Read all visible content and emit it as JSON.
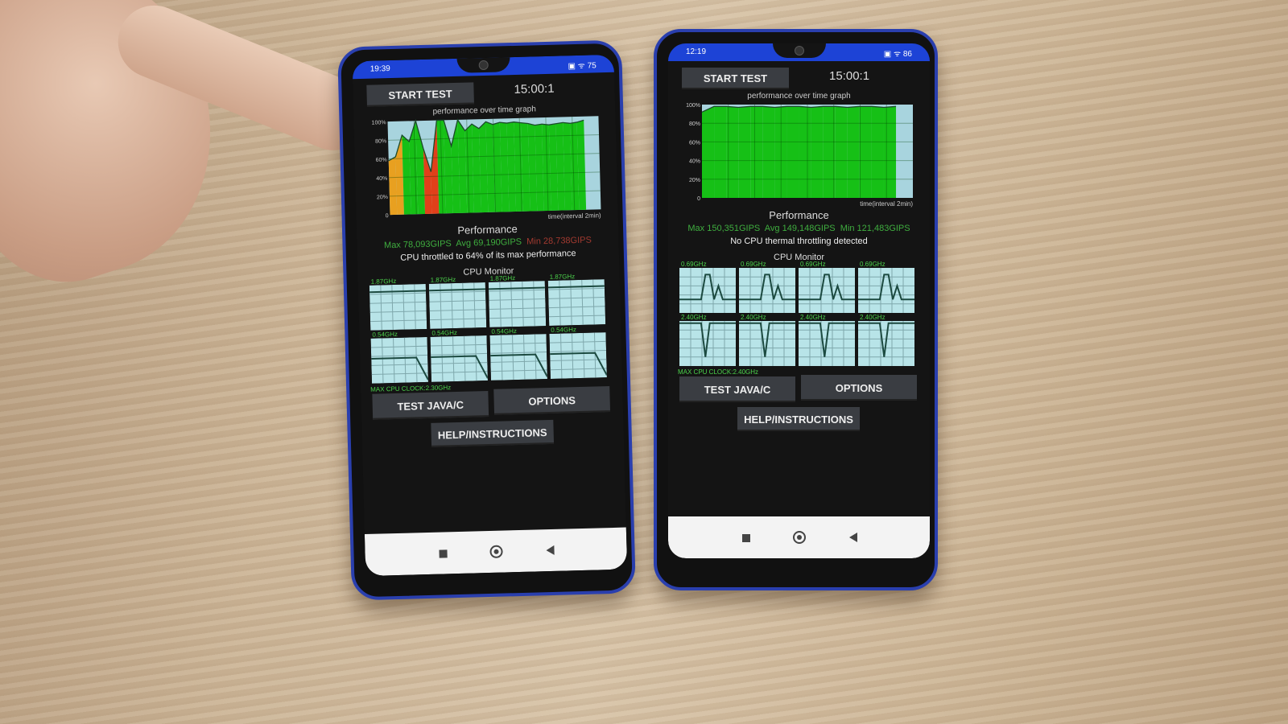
{
  "phones": [
    {
      "status_time": "19:39",
      "status_icons": "▣ ᯤ 75",
      "battery": "75",
      "start_test": "START TEST",
      "timer": "15:00:1",
      "graph_title": "performance over time graph",
      "y_ticks": [
        "100%",
        "80%",
        "60%",
        "40%",
        "20%",
        "0"
      ],
      "x_label": "time(interval 2min)",
      "perf_title": "Performance",
      "max": "Max 78,093GIPS",
      "avg": "Avg 69,190GIPS",
      "min": "Min 28,738GIPS",
      "message": "CPU throttled to 64% of its max performance",
      "cpu_monitor": "CPU Monitor",
      "core_freqs": [
        "1.87GHz",
        "1.87GHz",
        "1.87GHz",
        "1.87GHz",
        "0.54GHz",
        "0.54GHz",
        "0.54GHz",
        "0.54GHz"
      ],
      "max_cpu_clock": "MAX CPU CLOCK:2.30GHz",
      "test_java": "TEST JAVA/C",
      "options": "OPTIONS",
      "help": "HELP/INSTRUCTIONS",
      "chart_data": {
        "type": "area",
        "ylabel": "",
        "xlabel": "time(interval 2min)",
        "ylim": [
          0,
          100
        ],
        "values": [
          58,
          62,
          85,
          78,
          100,
          70,
          45,
          100,
          100,
          72,
          100,
          88,
          95,
          90,
          97,
          94,
          96,
          95,
          96,
          95,
          94,
          92,
          93,
          92,
          93,
          94,
          93,
          94,
          96
        ],
        "fill_end": 0.93
      },
      "core_graphs": {
        "top": [
          0.85,
          0.85,
          0.85,
          0.85,
          0.85,
          0.85
        ],
        "bottom": [
          0.55,
          0.55,
          0.55,
          0.55,
          0.55,
          0.05
        ]
      }
    },
    {
      "status_time": "12:19",
      "status_icons": "▣ ᯤ 86",
      "battery": "86",
      "start_test": "START TEST",
      "timer": "15:00:1",
      "graph_title": "performance over time graph",
      "y_ticks": [
        "100%",
        "80%",
        "60%",
        "40%",
        "20%",
        "0"
      ],
      "x_label": "time(interval 2min)",
      "perf_title": "Performance",
      "max": "Max 150,351GIPS",
      "avg": "Avg 149,148GIPS",
      "min": "Min 121,483GIPS",
      "message": "No CPU thermal throttling detected",
      "cpu_monitor": "CPU Monitor",
      "core_freqs": [
        "0.69GHz",
        "0.69GHz",
        "0.69GHz",
        "0.69GHz",
        "2.40GHz",
        "2.40GHz",
        "2.40GHz",
        "2.40GHz"
      ],
      "max_cpu_clock": "MAX CPU CLOCK:2.40GHz",
      "test_java": "TEST JAVA/C",
      "options": "OPTIONS",
      "help": "HELP/INSTRUCTIONS",
      "chart_data": {
        "type": "area",
        "ylabel": "",
        "xlabel": "time(interval 2min)",
        "ylim": [
          0,
          100
        ],
        "values": [
          92,
          98,
          98,
          97,
          98,
          98,
          97,
          98,
          98,
          97,
          98,
          98,
          97,
          98,
          98,
          97,
          98
        ],
        "fill_end": 0.92
      },
      "core_graphs": {
        "top": [
          0.3,
          0.3,
          0.3,
          0.3,
          0.3,
          0.3,
          0.85,
          0.85,
          0.3,
          0.6,
          0.3,
          0.3,
          0.3,
          0.3
        ],
        "bottom": [
          0.95,
          0.95,
          0.95,
          0.95,
          0.95,
          0.95,
          0.2,
          0.95,
          0.95,
          0.95,
          0.95,
          0.95,
          0.95,
          0.95
        ]
      }
    }
  ],
  "colors": {
    "good": "#16c016",
    "warn": "#e8a020",
    "bad": "#e0401a",
    "bg_chart": "#a8d4de",
    "stat_green": "#3fae3f",
    "stat_red": "#a23a30",
    "status_bar": "#1d43d6"
  }
}
